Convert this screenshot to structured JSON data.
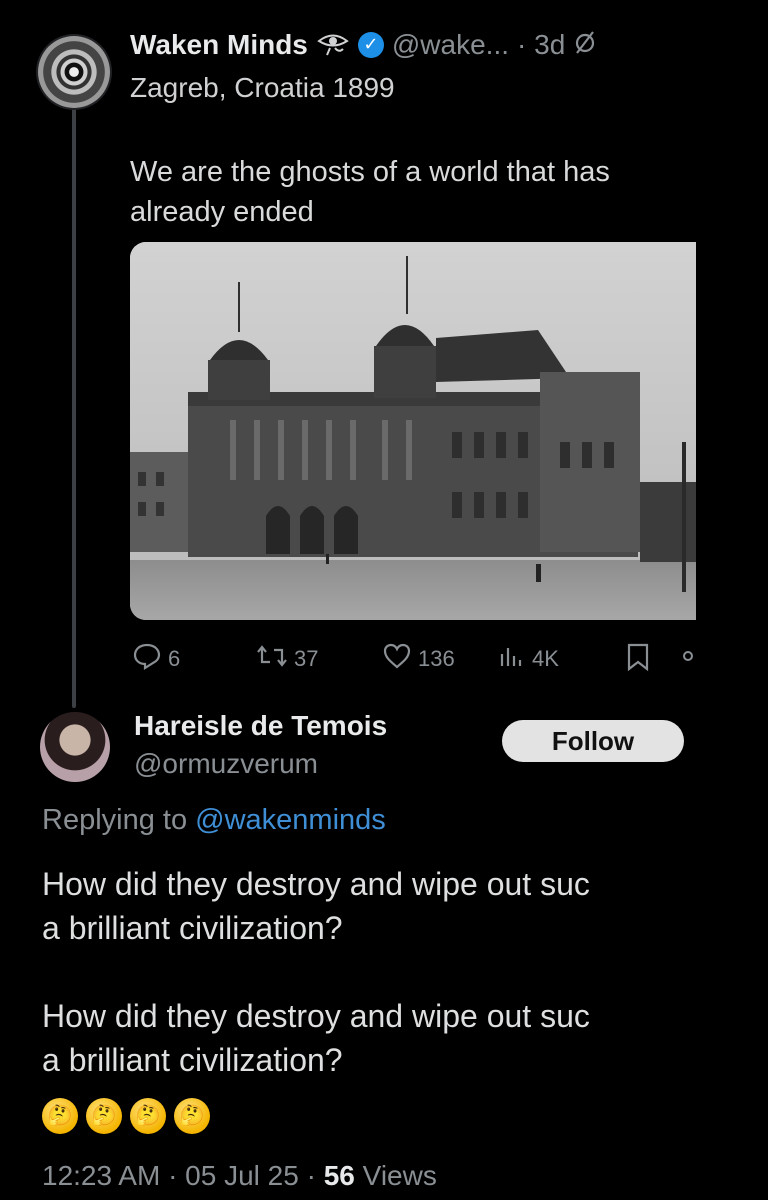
{
  "parent": {
    "name": "Waken Minds",
    "handle": "@wake...",
    "time": "· 3d",
    "location": "Zagreb, Croatia 1899",
    "text_line1": "We are the ghosts of a world that has",
    "text_line2": "already ended",
    "stats": {
      "replies": "6",
      "reposts": "37",
      "likes": "136",
      "views": "4K"
    }
  },
  "reply": {
    "name": "Hareisle de Temois",
    "handle": "@ormuzverum",
    "follow_label": "Follow",
    "replying_prefix": "Replying to",
    "replying_handle": "@wakenminds",
    "para1_line1": "How did they destroy and wipe out suc",
    "para1_line2": "a brilliant civilization?",
    "para2_line1": "How did they destroy and wipe out suc",
    "para2_line2": "a brilliant civilization?",
    "emojis": [
      "🤔",
      "🤔",
      "🤔",
      "🤔"
    ],
    "footer_time": "12:23 AM · 05 Jul 25 ·",
    "footer_views_count": "56",
    "footer_views_label": "Views"
  },
  "colors": {
    "background": "#000000",
    "link": "#3f8fd6",
    "verified": "#1d8fe6",
    "muted": "#8a8f94"
  }
}
